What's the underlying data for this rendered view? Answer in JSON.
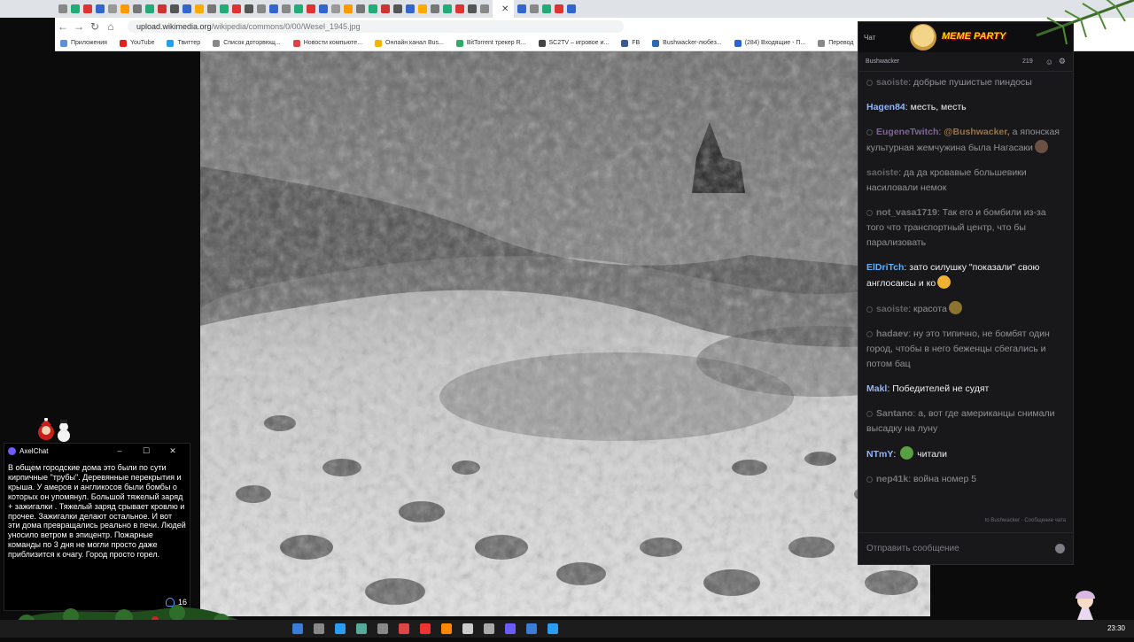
{
  "browser": {
    "url_host": "upload.wikimedia.org",
    "url_path": "/wikipedia/commons/0/00/Wesel_1945.jpg",
    "bookmarks": [
      {
        "label": "Приложения",
        "color": "#5f8fd6"
      },
      {
        "label": "YouTube",
        "color": "#e62117"
      },
      {
        "label": "Твиттер",
        "color": "#1da1f2"
      },
      {
        "label": "Список доторвющ...",
        "color": "#888888"
      },
      {
        "label": "Новости компьюте...",
        "color": "#d44"
      },
      {
        "label": "Онлайн канал Bus...",
        "color": "#f4b400"
      },
      {
        "label": "BitTorrent трекер R...",
        "color": "#3a6"
      },
      {
        "label": "SC2TV – игровое и...",
        "color": "#444"
      },
      {
        "label": "FB",
        "color": "#3b5998"
      },
      {
        "label": "Bushwacker-любез...",
        "color": "#2b6cb0"
      },
      {
        "label": "(284) Входящие - П...",
        "color": "#2a63d6"
      },
      {
        "label": "Перевод",
        "color": "#888"
      }
    ]
  },
  "chat": {
    "popout_title": "Чат",
    "meme_banner": "MEME PARTY",
    "channel": "Bushwacker",
    "viewers": "219",
    "messages": [
      {
        "user": "saoiste",
        "text": "добрые пушистые пиндосы",
        "user_color": "#a0a0a0",
        "dim": true,
        "badge": true
      },
      {
        "user": "Hagen84",
        "text": "месть, месть",
        "user_color": "#8fb5ff",
        "dim": false,
        "badge": false
      },
      {
        "user": "EugeneTwitch",
        "mention": "@Bushwacker,",
        "text": "а японская культурная жемчужина была Нагасаки",
        "user_color": "#d1a0ff",
        "dim": true,
        "badge": true,
        "emote": "#b08060"
      },
      {
        "user": "saoiste",
        "text": "да да кровавые большевики насиловали немок",
        "user_color": "#a0a0a0",
        "dim": true,
        "badge": false
      },
      {
        "user": "not_vasa1719",
        "text": "Так его и бомбили из-за того что транспортный центр, что бы парализовать",
        "user_color": "#c0c0c0",
        "dim": true,
        "badge": true
      },
      {
        "user": "ElDriTch",
        "text": "зато силушку \"показали\" свою англосаксы и ко",
        "user_color": "#5fb0ff",
        "dim": false,
        "badge": false,
        "emote": "#f0b030"
      },
      {
        "user": "saoiste",
        "text": "красота",
        "user_color": "#a0a0a0",
        "dim": true,
        "badge": true,
        "emote": "#e8c040"
      },
      {
        "user": "hadaev",
        "text": "ну это типично, не бомбят один город, чтобы в него беженцы сбегались и потом бац",
        "user_color": "#c0c0c0",
        "dim": true,
        "badge": true
      },
      {
        "user": "Makl",
        "text": "Победителей не судят",
        "user_color": "#8fb5ff",
        "dim": false,
        "badge": false
      },
      {
        "user": "Santano",
        "text": "а, вот где американцы снимали высадку на луну",
        "user_color": "#c0c0c0",
        "dim": true,
        "badge": true
      },
      {
        "user": "NTmY",
        "text": "читали",
        "user_color": "#8fb5ff",
        "dim": false,
        "badge": false,
        "emote_before": "#5aa040"
      },
      {
        "user": "nep41k",
        "text": "война номер 5",
        "user_color": "#c0c0c0",
        "dim": true,
        "badge": true
      }
    ],
    "footer": "to Bushwacker · Сообщение чата",
    "input_placeholder": "Отправить сообщение"
  },
  "axelchat": {
    "title": "AxelChat",
    "message": "В общем городские дома это были по сути кирпичные \"трубы\". Деревянные перекрытия и крыша. У амеров и англикосов были бомбы о которых он упомянул.  Большой тяжелый заряд + зажигалки . Тяжелый заряд срывает кровлю и прочее. Зажигалки делают остальное. И вот эти дома превращались реально в печи. Людей уносило ветром в эпицентр. Пожарные команды по 3 дня не могли просто даже приблизится к очагу. Город просто горел.",
    "viewer_count": "16"
  },
  "taskbar": {
    "clock": "23:30"
  }
}
